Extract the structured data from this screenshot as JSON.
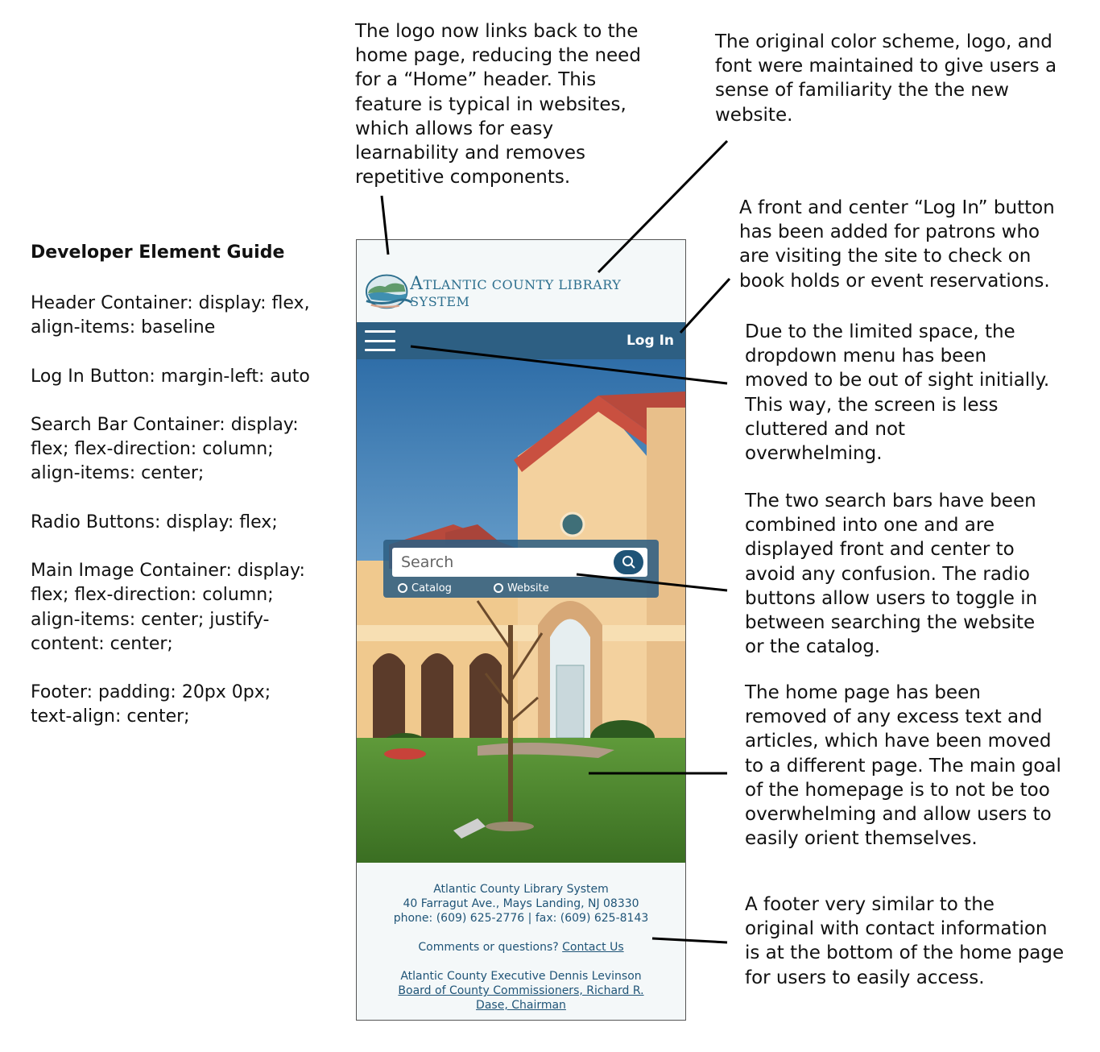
{
  "annotations": {
    "logo_note": "The logo now links back to the\nhome page, reducing the need\nfor a “Home” header. This\nfeature is typical in websites,\nwhich allows for easy\nlearnability and removes\nrepetitive components.",
    "color_note": "The original color scheme, logo, and\nfont were maintained to give users a\nsense of familiarity the the new\nwebsite.",
    "login_note": "A front and center “Log In” button\nhas been added for patrons who\nare visiting the site to check on\nbook holds or event reservations.",
    "menu_note": "Due to the limited space, the\ndropdown menu has been\nmoved to be out of sight initially.\nThis way, the screen is less\ncluttered and not\noverwhelming.",
    "search_note": "The two search bars have been\ncombined into one and are\ndisplayed front and center to\navoid any confusion. The radio\nbuttons allow users to toggle in\nbetween searching the website\nor the catalog.",
    "home_note": "The home page has been\nremoved of any excess text and\narticles, which have been moved\nto a different page. The main goal\nof the homepage is to not be too\noverwhelming and allow users to\neasily orient themselves.",
    "footer_note": "A footer very similar to the\noriginal with contact information\nis at the bottom of the home page\nfor users to easily access."
  },
  "guide": {
    "title": "Developer Element Guide",
    "items": [
      "Header Container: display: flex,\nalign-items: baseline",
      "Log In Button: margin-left: auto",
      "Search Bar Container: display:\nflex; flex-direction: column;\nalign-items: center;",
      "Radio Buttons: display: flex;",
      "Main Image Container:  display:\nflex; flex-direction: column;\nalign-items: center; justify-\ncontent: center;",
      "Footer: padding: 20px 0px;\ntext-align: center;"
    ]
  },
  "mockup": {
    "logo": {
      "first_letter": "A",
      "rest": "TLANTIC COUNTY LIBRARY SYSTEM"
    },
    "nav": {
      "menu_icon": "hamburger-icon",
      "login_label": "Log In"
    },
    "search": {
      "placeholder": "Search",
      "button_icon": "search-icon",
      "radio_catalog": "Catalog",
      "radio_website": "Website"
    },
    "footer": {
      "org_name": "Atlantic County Library System",
      "address": "40 Farragut Ave., Mays Landing, NJ 08330",
      "phone_line": "phone: (609) 625-2776 | fax: (609) 625-8143",
      "comments_prefix": "Comments or questions?",
      "contact_link": "Contact Us",
      "executive": "Atlantic County Executive Dennis Levinson",
      "board_link": "Board of County Commissioners, Richard R.\nDase, Chairman"
    }
  },
  "colors": {
    "brand_blue": "#2d5f83",
    "logo_blue": "#2d6f8e",
    "footer_text": "#1f5477"
  }
}
